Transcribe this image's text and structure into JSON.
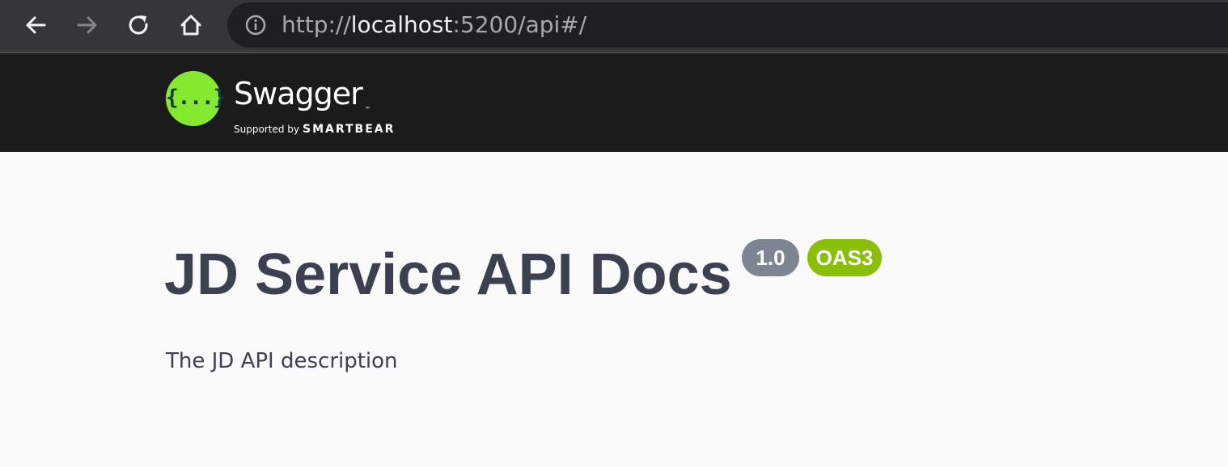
{
  "browser": {
    "url_prefix": "http://",
    "url_host": "localhost",
    "url_suffix": ":5200/api#/",
    "nav": {
      "back_icon": "arrow-left-icon",
      "forward_icon": "arrow-right-icon",
      "reload_icon": "reload-icon",
      "home_icon": "home-icon",
      "site_info_icon": "info-circle-icon"
    }
  },
  "header": {
    "logo_symbol": "{...}",
    "logo_name": "Swagger",
    "logo_tm": "™",
    "supported_by": "Supported by",
    "sponsor": "SMARTBEAR",
    "colors": {
      "background": "#1b1b1b",
      "logo_green": "#85ea2d",
      "logo_symbol": "#173647"
    }
  },
  "info": {
    "title": "JD Service API Docs",
    "version_badge": "1.0",
    "spec_badge": "OAS3",
    "description": "The JD API description",
    "colors": {
      "title": "#3b4151",
      "version_badge": "#7d8492",
      "spec_badge": "#89bf04"
    }
  }
}
